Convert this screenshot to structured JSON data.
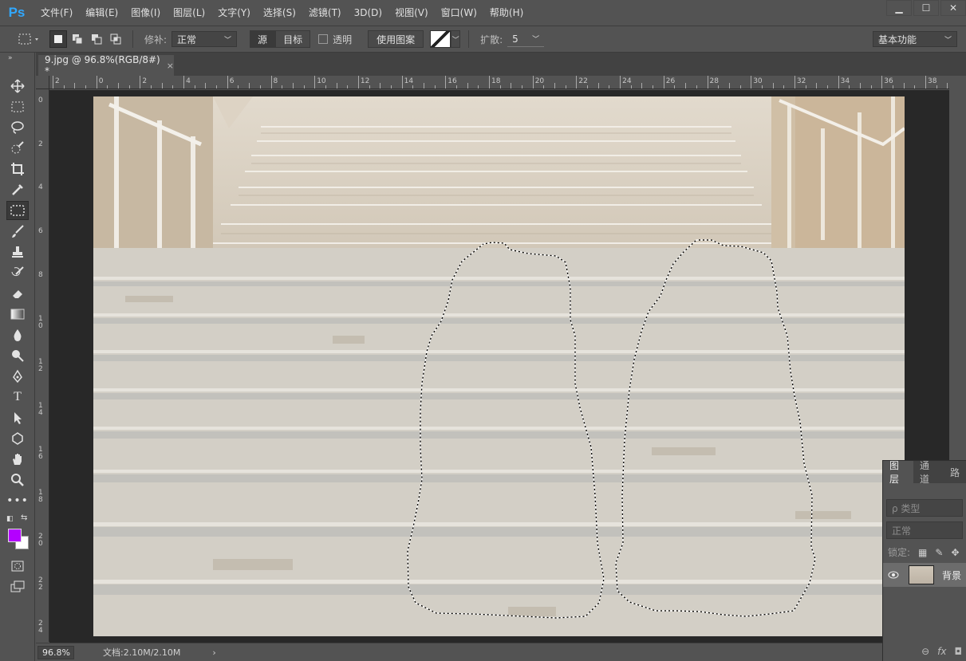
{
  "app": {
    "logo": "Ps"
  },
  "menu": [
    "文件(F)",
    "编辑(E)",
    "图像(I)",
    "图层(L)",
    "文字(Y)",
    "选择(S)",
    "滤镜(T)",
    "3D(D)",
    "视图(V)",
    "窗口(W)",
    "帮助(H)"
  ],
  "window_controls": {
    "minimize": "▁",
    "restore": "☐",
    "close": "✕"
  },
  "options": {
    "patch_label": "修补:",
    "patch_value": "正常",
    "source_label": "源",
    "target_label": "目标",
    "transparent_label": "透明",
    "use_pattern_label": "使用图案",
    "spread_label": "扩散:",
    "spread_value": "5",
    "workspace": "基本功能"
  },
  "document": {
    "tab_title": "9.jpg @ 96.8%(RGB/8#) *",
    "close": "×"
  },
  "ruler": {
    "h_labels": [
      "2",
      "0",
      "2",
      "4",
      "6",
      "8",
      "10",
      "12",
      "14",
      "16",
      "18",
      "20",
      "22",
      "24",
      "26",
      "28",
      "30",
      "32",
      "34",
      "36",
      "38"
    ],
    "v_labels": [
      "0",
      "2",
      "4",
      "6",
      "8",
      "10",
      "12",
      "14",
      "16",
      "18",
      "20",
      "22",
      "24"
    ]
  },
  "status": {
    "zoom": "96.8%",
    "doc_info": "文档:2.10M/2.10M",
    "arrow": "›"
  },
  "layers_panel": {
    "tabs": [
      "图层",
      "通道",
      "路"
    ],
    "filter_placeholder": "ρ 类型",
    "blend_mode": "正常",
    "lock_label": "锁定:",
    "layer_name": "背景"
  },
  "colors": {
    "foreground": "#b400ff",
    "background": "#ffffff"
  }
}
